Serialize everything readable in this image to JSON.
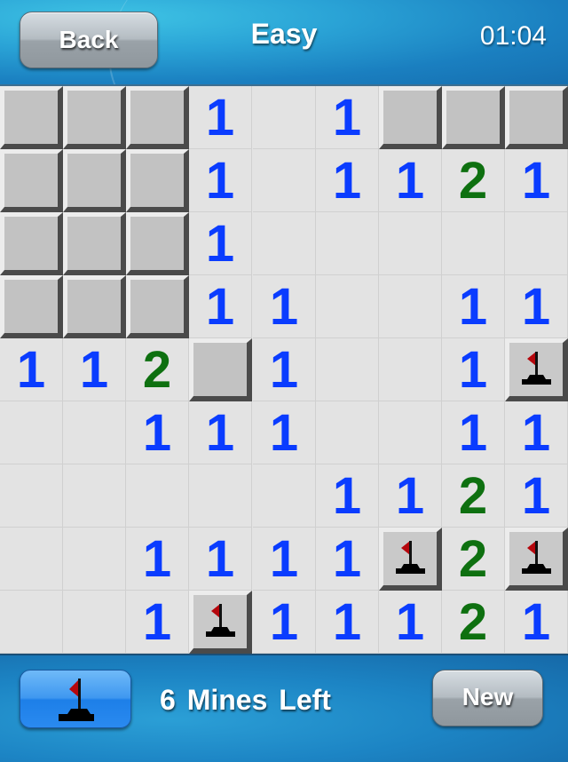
{
  "header": {
    "back_label": "Back",
    "title": "Easy",
    "timer": "01:04"
  },
  "board": {
    "columns": 9,
    "rows": 9,
    "legend": {
      "C": "covered",
      "F": "flagged",
      "0": "empty",
      "1": "number-1",
      "2": "number-2"
    },
    "number_colors": {
      "1": "#0a3cff",
      "2": "#0e7010"
    },
    "cells": [
      [
        "C",
        "C",
        "C",
        "1",
        "0",
        "1",
        "C",
        "C",
        "C"
      ],
      [
        "C",
        "C",
        "C",
        "1",
        "0",
        "1",
        "1",
        "2",
        "1"
      ],
      [
        "C",
        "C",
        "C",
        "1",
        "0",
        "0",
        "0",
        "0",
        "0"
      ],
      [
        "C",
        "C",
        "C",
        "1",
        "1",
        "0",
        "0",
        "1",
        "1"
      ],
      [
        "1",
        "1",
        "2",
        "C",
        "1",
        "0",
        "0",
        "1",
        "F"
      ],
      [
        "0",
        "0",
        "1",
        "1",
        "1",
        "0",
        "0",
        "1",
        "1"
      ],
      [
        "0",
        "0",
        "0",
        "0",
        "0",
        "1",
        "1",
        "2",
        "1"
      ],
      [
        "0",
        "0",
        "1",
        "1",
        "1",
        "1",
        "F",
        "2",
        "F"
      ],
      [
        "0",
        "0",
        "1",
        "F",
        "1",
        "1",
        "1",
        "2",
        "1"
      ]
    ]
  },
  "footer": {
    "flag_mode_icon": "flag-icon",
    "mines_left_text": "6 Mines Left",
    "new_label": "New"
  }
}
